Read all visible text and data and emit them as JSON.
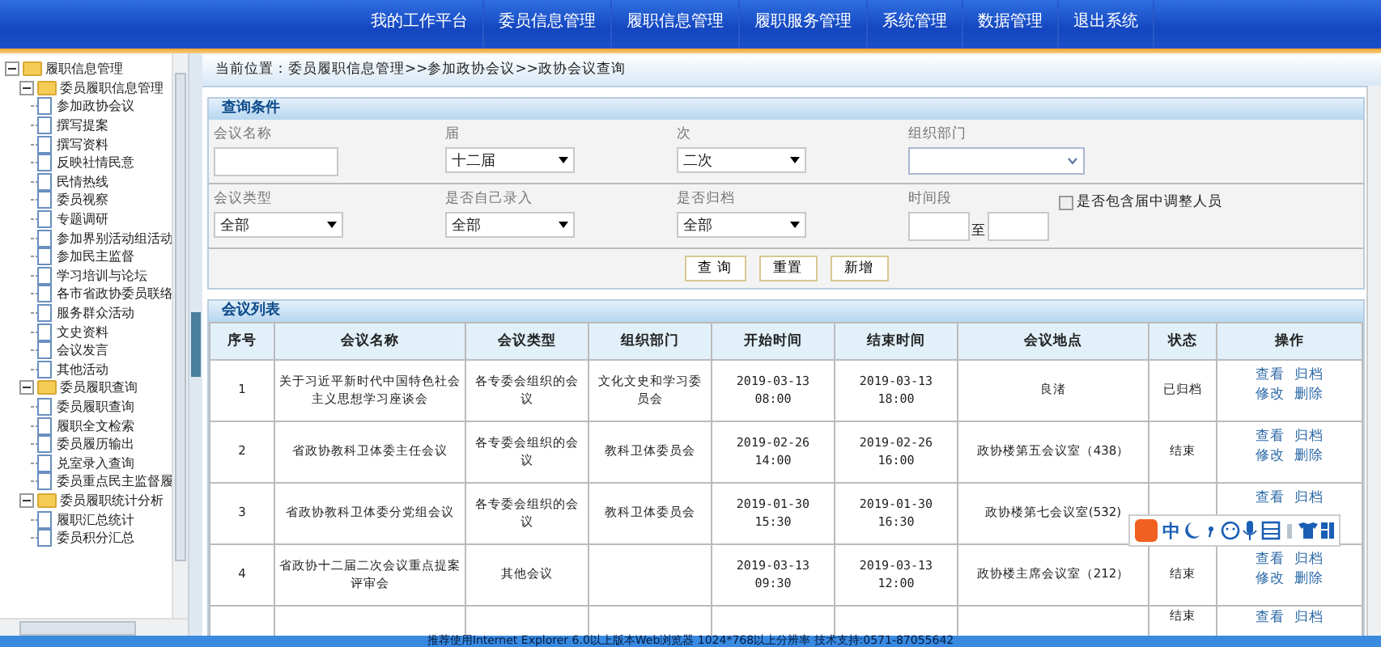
{
  "nav": [
    {
      "label": "我的工作平台"
    },
    {
      "label": "委员信息管理"
    },
    {
      "label": "履职信息管理"
    },
    {
      "label": "履职服务管理"
    },
    {
      "label": "系统管理"
    },
    {
      "label": "数据管理"
    },
    {
      "label": "退出系统"
    }
  ],
  "tree": [
    {
      "label": "履职信息管理",
      "expanded": true,
      "children": [
        {
          "label": "委员履职信息管理",
          "expanded": true,
          "children": [
            {
              "label": "参加政协会议"
            },
            {
              "label": "撰写提案"
            },
            {
              "label": "撰写资料"
            },
            {
              "label": "反映社情民意"
            },
            {
              "label": "民情热线"
            },
            {
              "label": "委员视察"
            },
            {
              "label": "专题调研"
            },
            {
              "label": "参加界别活动组活动"
            },
            {
              "label": "参加民主监督"
            },
            {
              "label": "学习培训与论坛"
            },
            {
              "label": "各市省政协委员联络"
            },
            {
              "label": "服务群众活动"
            },
            {
              "label": "文史资料"
            },
            {
              "label": "会议发言"
            },
            {
              "label": "其他活动"
            }
          ]
        },
        {
          "label": "委员履职查询",
          "expanded": true,
          "children": [
            {
              "label": "委员履职查询"
            },
            {
              "label": "履职全文检索"
            },
            {
              "label": "委员履历输出"
            },
            {
              "label": "兑室录入查询"
            },
            {
              "label": "委员重点民主监督履"
            }
          ]
        },
        {
          "label": "委员履职统计分析",
          "expanded": true,
          "children": [
            {
              "label": "履职汇总统计"
            },
            {
              "label": "委员积分汇总"
            }
          ]
        }
      ]
    }
  ],
  "breadcrumb": "当前位置：委员履职信息管理>>参加政协会议>>政协会议查询",
  "query": {
    "title": "查询条件",
    "row1": [
      {
        "kind": "input",
        "label": "会议名称"
      },
      {
        "kind": "select",
        "label": "届",
        "value": "十二届"
      },
      {
        "kind": "select",
        "label": "次",
        "value": "二次"
      },
      {
        "kind": "combo",
        "label": "组织部门"
      }
    ],
    "row2": [
      {
        "kind": "select",
        "label": "会议类型",
        "value": "全部"
      },
      {
        "kind": "select",
        "label": "是否自己录入",
        "value": "全部"
      },
      {
        "kind": "select",
        "label": "是否归档",
        "value": "全部"
      },
      {
        "kind": "range",
        "label": "时间段",
        "separator": "至"
      }
    ],
    "include_checkbox": {
      "label": "是否包含届中调整人员",
      "checked": false
    },
    "buttons": [
      "查 询",
      "重置",
      "新增"
    ]
  },
  "list": {
    "title": "会议列表",
    "columns": [
      "序号",
      "会议名称",
      "会议类型",
      "组织部门",
      "开始时间",
      "结束时间",
      "会议地点",
      "状态",
      "操作"
    ],
    "rows": [
      {
        "no": "1",
        "name": "关于习近平新时代中国特色社会主义思想学习座谈会",
        "type": "各专委会组织的会议",
        "dept": "文化文史和学习委员会",
        "start": "2019-03-13 08:00",
        "end": "2019-03-13 18:00",
        "place": "良渚",
        "status": "已归档",
        "actions": [
          "查看",
          "归档",
          "修改",
          "删除"
        ]
      },
      {
        "no": "2",
        "name": "省政协教科卫体委主任会议",
        "type": "各专委会组织的会议",
        "dept": "教科卫体委员会",
        "start": "2019-02-26 14:00",
        "end": "2019-02-26 16:00",
        "place": "政协楼第五会议室（438）",
        "status": "结束",
        "actions": [
          "查看",
          "归档",
          "修改",
          "删除"
        ]
      },
      {
        "no": "3",
        "name": "省政协教科卫体委分党组会议",
        "type": "各专委会组织的会议",
        "dept": "教科卫体委员会",
        "start": "2019-01-30 15:30",
        "end": "2019-01-30 16:30",
        "place": "政协楼第七会议室(532)",
        "actions": [
          "查看",
          "归档"
        ]
      },
      {
        "no": "4",
        "name": "省政协十二届二次会议重点提案评审会",
        "type": "其他会议",
        "start": "2019-03-13 09:30",
        "end": "2019-03-13 12:00",
        "place": "政协楼主席会议室（212）",
        "status": "结束",
        "actions": [
          "查看",
          "归档",
          "修改",
          "删除"
        ]
      },
      {
        "status": "结束",
        "actions": [
          "查看",
          "归档"
        ]
      }
    ]
  },
  "ime": {
    "label": "中"
  },
  "footer": "推荐使用Internet Explorer 6.0以上版本Web浏览器 1024*768以上分辨率 技术支持:0571-87055642"
}
